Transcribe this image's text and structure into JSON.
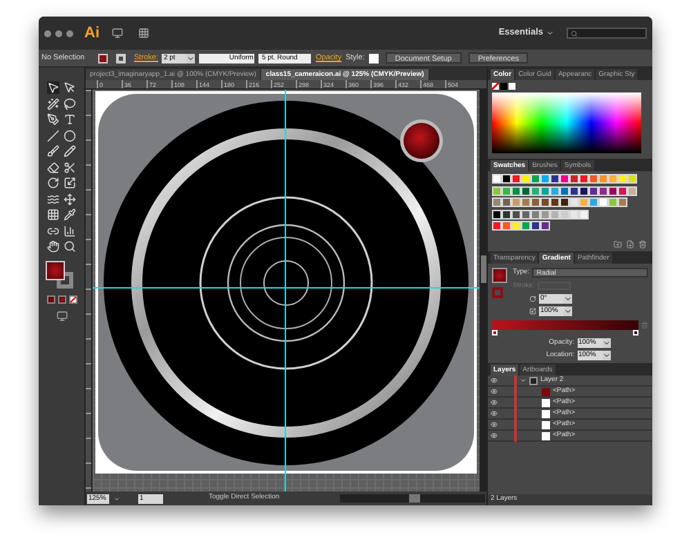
{
  "window": {
    "logo": "Ai",
    "workspace": "Essentials"
  },
  "control_bar": {
    "selection": "No Selection",
    "stroke_label": "Stroke:",
    "stroke_weight": "2 pt",
    "profile": "Uniform",
    "brush": "5 pt. Round",
    "opacity_label": "Opacity",
    "style_label": "Style:",
    "buttons": [
      "Document Setup",
      "Preferences"
    ]
  },
  "document_tabs": [
    {
      "label": "project3_imaginaryapp_1.ai @ 100% (CMYK/Preview)",
      "selected": false
    },
    {
      "label": "class15_cameraicon.ai @ 125% (CMYK/Preview)",
      "selected": true
    }
  ],
  "ruler": {
    "ticks": [
      "0",
      "36",
      "72",
      "108",
      "144",
      "180",
      "216",
      "252",
      "288",
      "324",
      "360",
      "396",
      "432",
      "468",
      "504"
    ]
  },
  "color_panel": {
    "tabs": [
      {
        "label": "Color",
        "selected": true
      },
      {
        "label": "Color Guid",
        "selected": false
      },
      {
        "label": "Appearanc",
        "selected": false
      },
      {
        "label": "Graphic Sty",
        "selected": false
      }
    ]
  },
  "swatches_panel": {
    "tabs": [
      {
        "label": "Swatches",
        "selected": true
      },
      {
        "label": "Brushes",
        "selected": false
      },
      {
        "label": "Symbols",
        "selected": false
      }
    ],
    "swatch_rows": [
      {
        "swatches": [
          {
            "color": "#ffffff"
          },
          {
            "color": "#000000"
          },
          {
            "color": "#ed1c24"
          },
          {
            "color": "#fff200"
          },
          {
            "color": "#00a651"
          },
          {
            "color": "#00aeef"
          },
          {
            "color": "#2e3192"
          },
          {
            "color": "#ec008c"
          },
          {
            "color": "#c1272d"
          },
          {
            "color": "#ed1c24"
          },
          {
            "color": "#f15a24"
          },
          {
            "color": "#f7931e"
          },
          {
            "color": "#fbb03b"
          },
          {
            "color": "#fcee21"
          },
          {
            "color": "#d9e021"
          }
        ]
      },
      {
        "swatches": [
          {
            "color": "#8cc63f"
          },
          {
            "color": "#39b54a"
          },
          {
            "color": "#009245"
          },
          {
            "color": "#006837"
          },
          {
            "color": "#22b573"
          },
          {
            "color": "#00a99d"
          },
          {
            "color": "#29abe2"
          },
          {
            "color": "#0071bc"
          },
          {
            "color": "#2e3192"
          },
          {
            "color": "#1b1464"
          },
          {
            "color": "#662d91"
          },
          {
            "color": "#93278f"
          },
          {
            "color": "#9e005d"
          },
          {
            "color": "#d4145a"
          },
          {
            "color": "#c7b299"
          }
        ]
      },
      {
        "swatches": [
          {
            "color": "#998675"
          },
          {
            "color": "#736357"
          },
          {
            "color": "#c69c6d"
          },
          {
            "color": "#a67c52"
          },
          {
            "color": "#8c6239"
          },
          {
            "color": "#754c24"
          },
          {
            "color": "#603813"
          },
          {
            "color": "#42210b"
          },
          {
            "color": "#e6e6e6"
          },
          {
            "color": "#fbb03b"
          },
          {
            "color": "#29abe2"
          },
          {
            "color": "#ffffff"
          },
          {
            "color": "#8cc63f"
          },
          {
            "color": "#a67c52"
          }
        ]
      },
      {
        "swatches": [
          {
            "color": "#000000"
          },
          {
            "color": "#333333"
          },
          {
            "color": "#4d4d4d"
          },
          {
            "color": "#666666"
          },
          {
            "color": "#808080"
          },
          {
            "color": "#999999"
          },
          {
            "color": "#b3b3b3"
          },
          {
            "color": "#cccccc"
          },
          {
            "color": "#e6e6e6"
          },
          {
            "color": "#f2f2f2"
          }
        ]
      },
      {
        "swatches": [
          {
            "color": "#ed1c24"
          },
          {
            "color": "#f15a24"
          },
          {
            "color": "#fcee21"
          },
          {
            "color": "#00a651"
          },
          {
            "color": "#2e3192"
          },
          {
            "color": "#662d91"
          }
        ]
      }
    ]
  },
  "gradient_panel": {
    "tabs": [
      {
        "label": "Transparency",
        "selected": false
      },
      {
        "label": "Gradient",
        "selected": true
      },
      {
        "label": "Pathfinder",
        "selected": false
      }
    ],
    "type_label": "Type:",
    "type": "Radial",
    "stroke_label": "Stroke:",
    "stroke_disabled": true,
    "angle": "0°",
    "aspect": "100%",
    "stops": [
      {
        "color": "#b3121c"
      },
      {
        "color": "#3a0406"
      }
    ],
    "opacity_label": "Opacity:",
    "opacity": "100%",
    "location_label": "Location:",
    "location": "100%"
  },
  "layers_panel": {
    "tabs": [
      {
        "label": "Layers",
        "selected": true
      },
      {
        "label": "Artboards",
        "selected": false
      }
    ],
    "layers": [
      {
        "name": "Layer 2",
        "expanded": true,
        "children": [
          {
            "name": "<Path>",
            "color": "#7a0a0e"
          },
          {
            "name": "<Path>",
            "color": "#ffffff"
          },
          {
            "name": "<Path>",
            "color": "#ffffff"
          },
          {
            "name": "<Path>",
            "color": "#ffffff"
          },
          {
            "name": "<Path>",
            "color": "#ffffff"
          }
        ]
      }
    ],
    "footer": "2 Layers"
  },
  "status_bar": {
    "zoom": "125%",
    "artboard": "1",
    "message": "Toggle Direct Selection"
  }
}
